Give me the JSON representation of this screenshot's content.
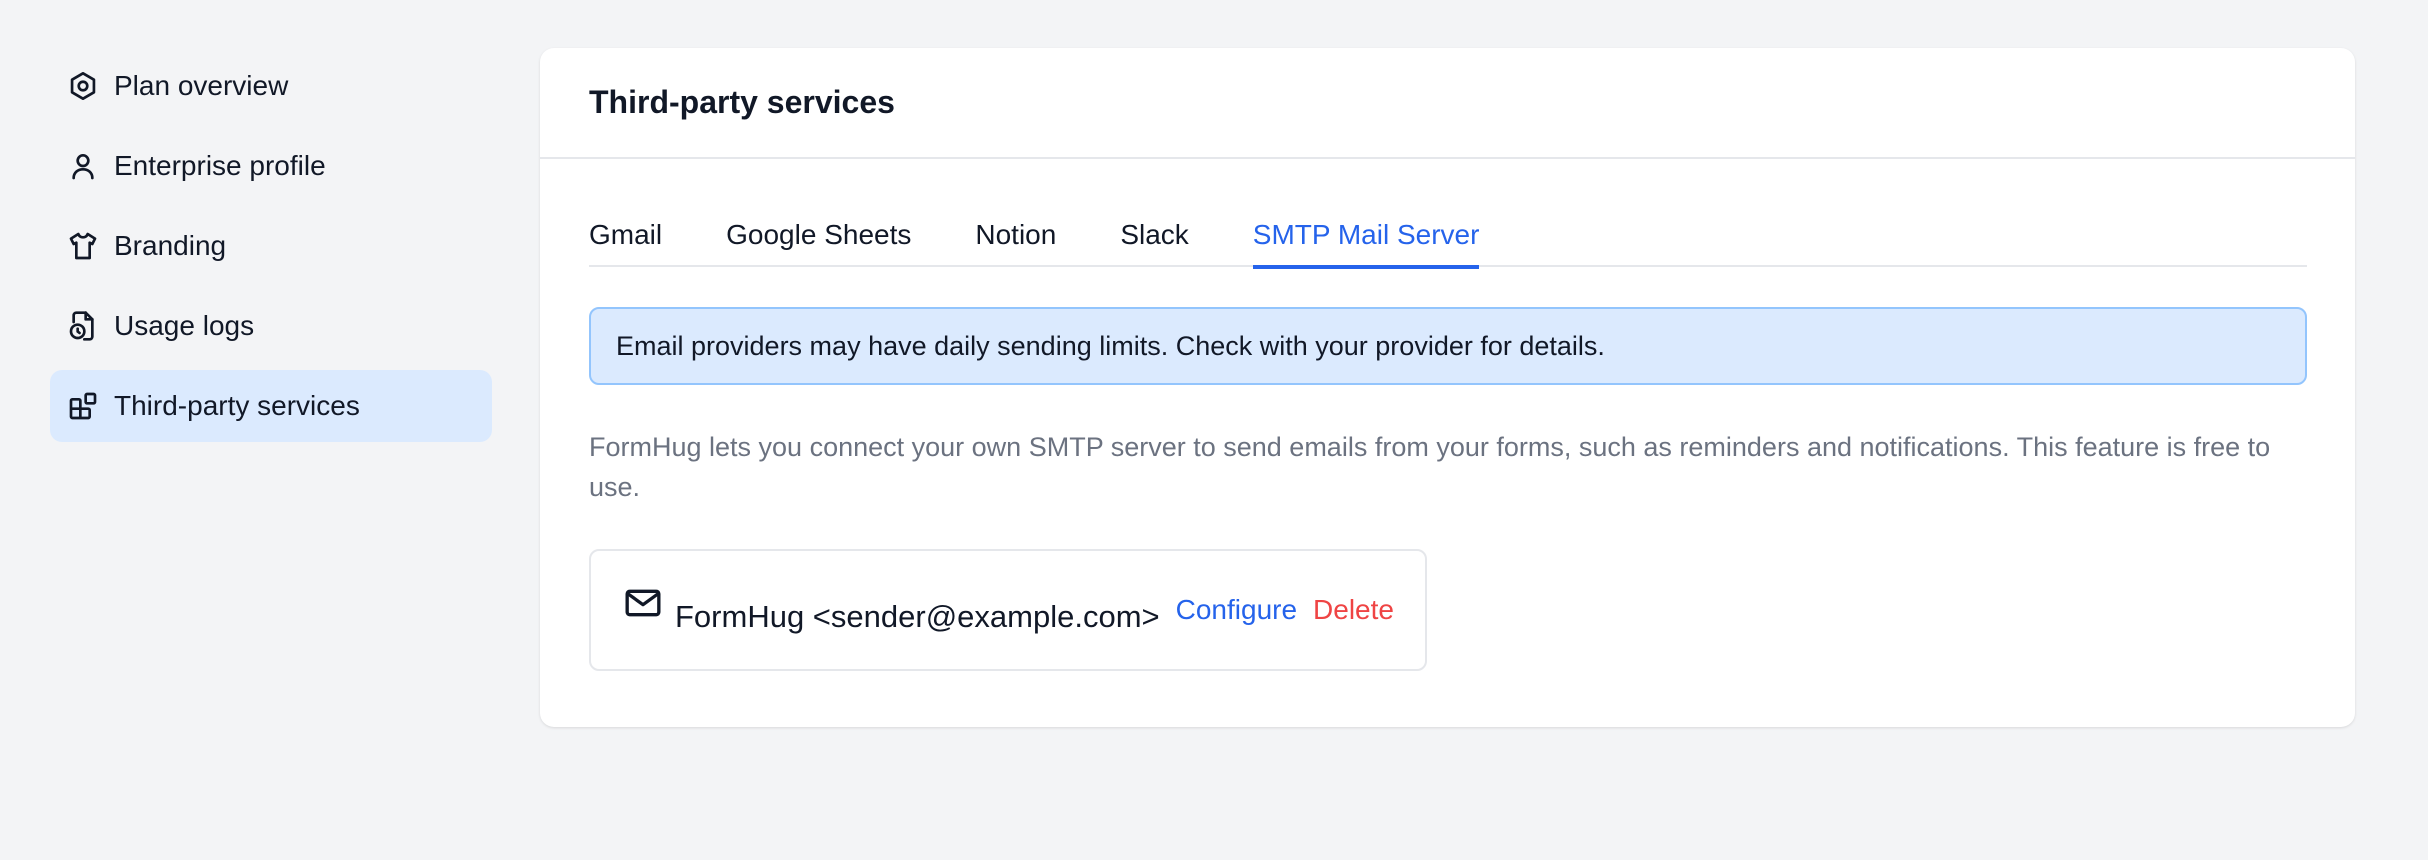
{
  "sidebar": {
    "items": [
      {
        "label": "Plan overview",
        "icon": "hexagon-settings-icon"
      },
      {
        "label": "Enterprise profile",
        "icon": "user-icon"
      },
      {
        "label": "Branding",
        "icon": "shirt-icon"
      },
      {
        "label": "Usage logs",
        "icon": "file-clock-icon"
      },
      {
        "label": "Third-party services",
        "icon": "blocks-icon",
        "active": true
      }
    ]
  },
  "card": {
    "title": "Third-party services",
    "tabs": [
      {
        "label": "Gmail"
      },
      {
        "label": "Google Sheets"
      },
      {
        "label": "Notion"
      },
      {
        "label": "Slack"
      },
      {
        "label": "SMTP Mail Server",
        "active": true
      }
    ],
    "alert": "Email providers may have daily sending limits. Check with your provider for details.",
    "description": "FormHug lets you connect your own SMTP server to send emails from your forms, such as reminders and notifications. This feature is free to use.",
    "service": {
      "name": "FormHug <sender@example.com>",
      "icon": "mail-icon",
      "configure_label": "Configure",
      "delete_label": "Delete"
    }
  },
  "colors": {
    "accent": "#2563eb",
    "active_bg": "#dbeafe",
    "danger": "#ef4444",
    "muted_text": "#6b7280",
    "page_bg": "#f3f4f6"
  }
}
